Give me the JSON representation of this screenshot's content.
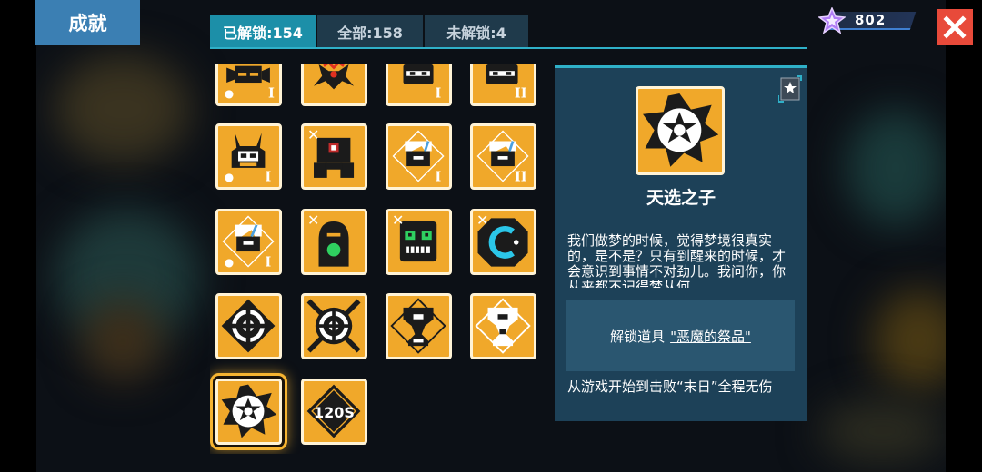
{
  "header": {
    "title": "成就"
  },
  "tabs": [
    {
      "label": "已解锁:154",
      "active": true
    },
    {
      "label": "全部:158",
      "active": false
    },
    {
      "label": "未解锁:4",
      "active": false
    }
  ],
  "currency": {
    "value": "802",
    "icon": "star-gem-icon"
  },
  "close": {
    "icon": "close-icon"
  },
  "achievements": [
    {
      "name": "skull-robot-1",
      "mark": "I"
    },
    {
      "name": "red-spider",
      "mark": ""
    },
    {
      "name": "helmet-robot-1",
      "mark": "I"
    },
    {
      "name": "helmet-robot-2",
      "mark": "II"
    },
    {
      "name": "horned-robot-1",
      "mark": "I"
    },
    {
      "name": "red-eye-mech",
      "mark": ""
    },
    {
      "name": "white-hair-1",
      "mark": "I"
    },
    {
      "name": "white-hair-2",
      "mark": "II"
    },
    {
      "name": "white-hair-3",
      "mark": "I"
    },
    {
      "name": "green-ghost",
      "mark": ""
    },
    {
      "name": "zombie-face",
      "mark": ""
    },
    {
      "name": "cyan-coin",
      "mark": ""
    },
    {
      "name": "target-diamond",
      "mark": ""
    },
    {
      "name": "target-cross",
      "mark": ""
    },
    {
      "name": "trophy-dark",
      "mark": ""
    },
    {
      "name": "trophy-white",
      "mark": ""
    },
    {
      "name": "chosen-one",
      "mark": ""
    },
    {
      "name": "120s",
      "mark": "120S"
    }
  ],
  "detail": {
    "name": "天选之子",
    "description": "我们做梦的时候，觉得梦境很真实的，是不是？只有到醒来的时候，才会意识到事情不对劲儿。我问你，你从来都不记得梦从何",
    "unlock_label": "解锁道具",
    "unlock_item": "\"恶魔的祭品\"",
    "condition": "从游戏开始到击败“末日”全程无伤",
    "share_icon": "share-icon"
  },
  "colors": {
    "accent": "#2fb0c8",
    "tile": "#f0a82a",
    "close": "#e84a3a",
    "panel": "#1d4158"
  }
}
